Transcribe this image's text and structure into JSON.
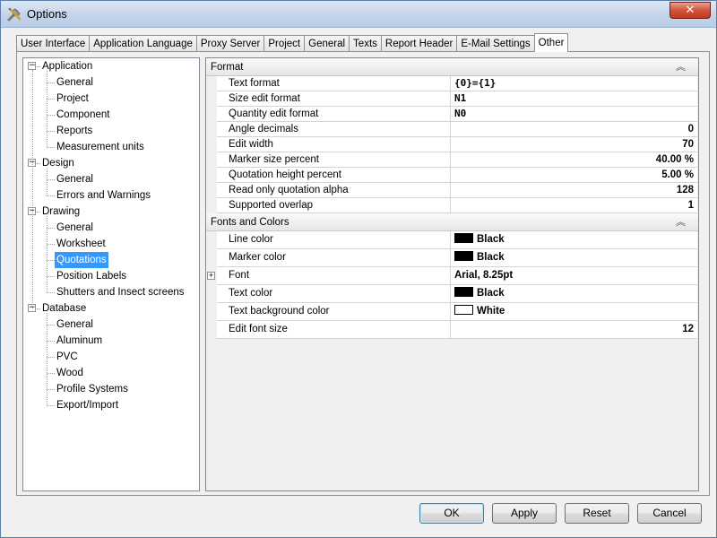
{
  "window": {
    "title": "Options",
    "close_label": "✕"
  },
  "tabs": [
    {
      "label": "User Interface"
    },
    {
      "label": "Application Language"
    },
    {
      "label": "Proxy Server"
    },
    {
      "label": "Project"
    },
    {
      "label": "General"
    },
    {
      "label": "Texts"
    },
    {
      "label": "Report Header"
    },
    {
      "label": "E-Mail Settings"
    },
    {
      "label": "Other",
      "active": true
    }
  ],
  "tree": {
    "groups": [
      {
        "label": "Application",
        "children": [
          "General",
          "Project",
          "Component",
          "Reports",
          "Measurement units"
        ]
      },
      {
        "label": "Design",
        "children": [
          "General",
          "Errors and Warnings"
        ]
      },
      {
        "label": "Drawing",
        "children": [
          "General",
          "Worksheet",
          "Quotations",
          "Position Labels",
          "Shutters and Insect screens"
        ]
      },
      {
        "label": "Database",
        "children": [
          "General",
          "Aluminum",
          "PVC",
          "Wood",
          "Profile Systems",
          "Export/Import"
        ]
      }
    ],
    "selected": "Quotations",
    "expanded_glyph": "−"
  },
  "grid": {
    "collapse_glyph": "︽",
    "expand_glyph": "+",
    "format": {
      "title": "Format",
      "rows": [
        {
          "name": "Text format",
          "value": "{0}={1}"
        },
        {
          "name": "Size edit format",
          "value": "N1"
        },
        {
          "name": "Quantity edit format",
          "value": "N0"
        },
        {
          "name": "Angle decimals",
          "value": "0"
        },
        {
          "name": "Edit width",
          "value": "70"
        },
        {
          "name": "Marker size percent",
          "value": "40.00 %"
        },
        {
          "name": "Quotation height percent",
          "value": "5.00 %"
        },
        {
          "name": "Read only quotation alpha",
          "value": "128"
        },
        {
          "name": "Supported overlap",
          "value": "1"
        }
      ]
    },
    "fonts": {
      "title": "Fonts and Colors",
      "rows": [
        {
          "name": "Line color",
          "value": "Black",
          "swatch": "#000000"
        },
        {
          "name": "Marker color",
          "value": "Black",
          "swatch": "#000000"
        },
        {
          "name": "Font",
          "value": "Arial, 8.25pt"
        },
        {
          "name": "Text color",
          "value": "Black",
          "swatch": "#000000"
        },
        {
          "name": "Text background color",
          "value": "White",
          "swatch": "#ffffff"
        },
        {
          "name": "Edit font size",
          "value": "12"
        }
      ]
    }
  },
  "buttons": {
    "ok": "OK",
    "apply": "Apply",
    "reset": "Reset",
    "cancel": "Cancel"
  }
}
